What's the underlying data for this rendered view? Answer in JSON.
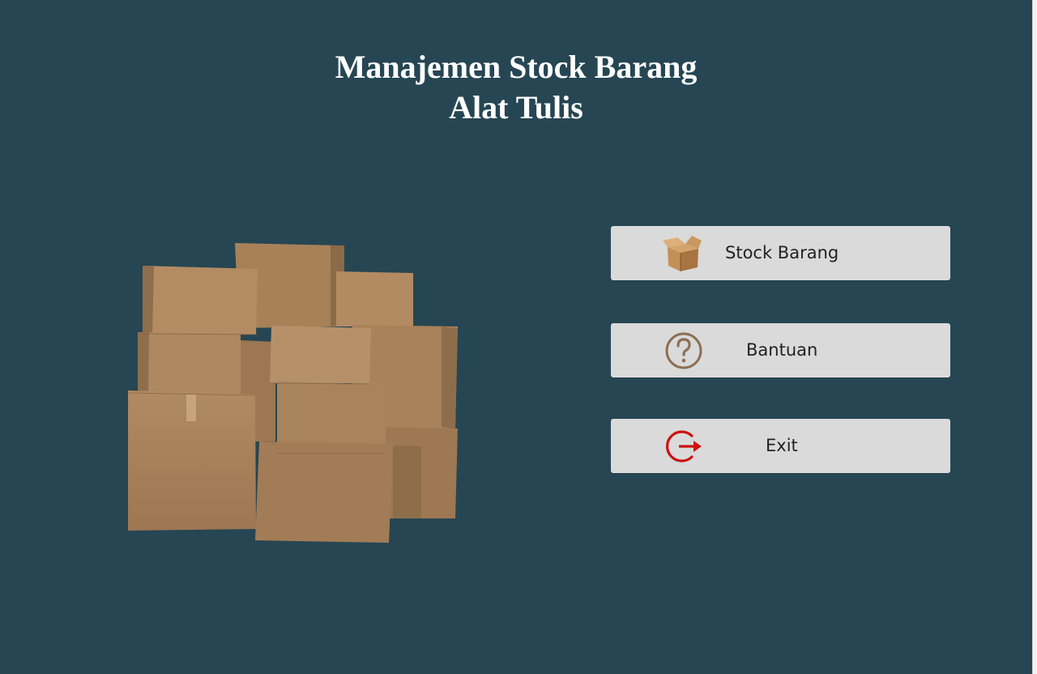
{
  "app": {
    "title_line1": "Manajemen Stock Barang",
    "title_line2": "Alat Tulis",
    "background_color": "#264653"
  },
  "illustration": {
    "icon": "cardboard-boxes-image"
  },
  "menu": [
    {
      "id": "stock",
      "label": "Stock Barang",
      "icon": "open-box-icon"
    },
    {
      "id": "help",
      "label": "Bantuan",
      "icon": "question-circle-icon",
      "icon_color": "#8b6f55"
    },
    {
      "id": "exit",
      "label": "Exit",
      "icon": "exit-arrow-icon",
      "icon_color": "#cc1111"
    }
  ]
}
